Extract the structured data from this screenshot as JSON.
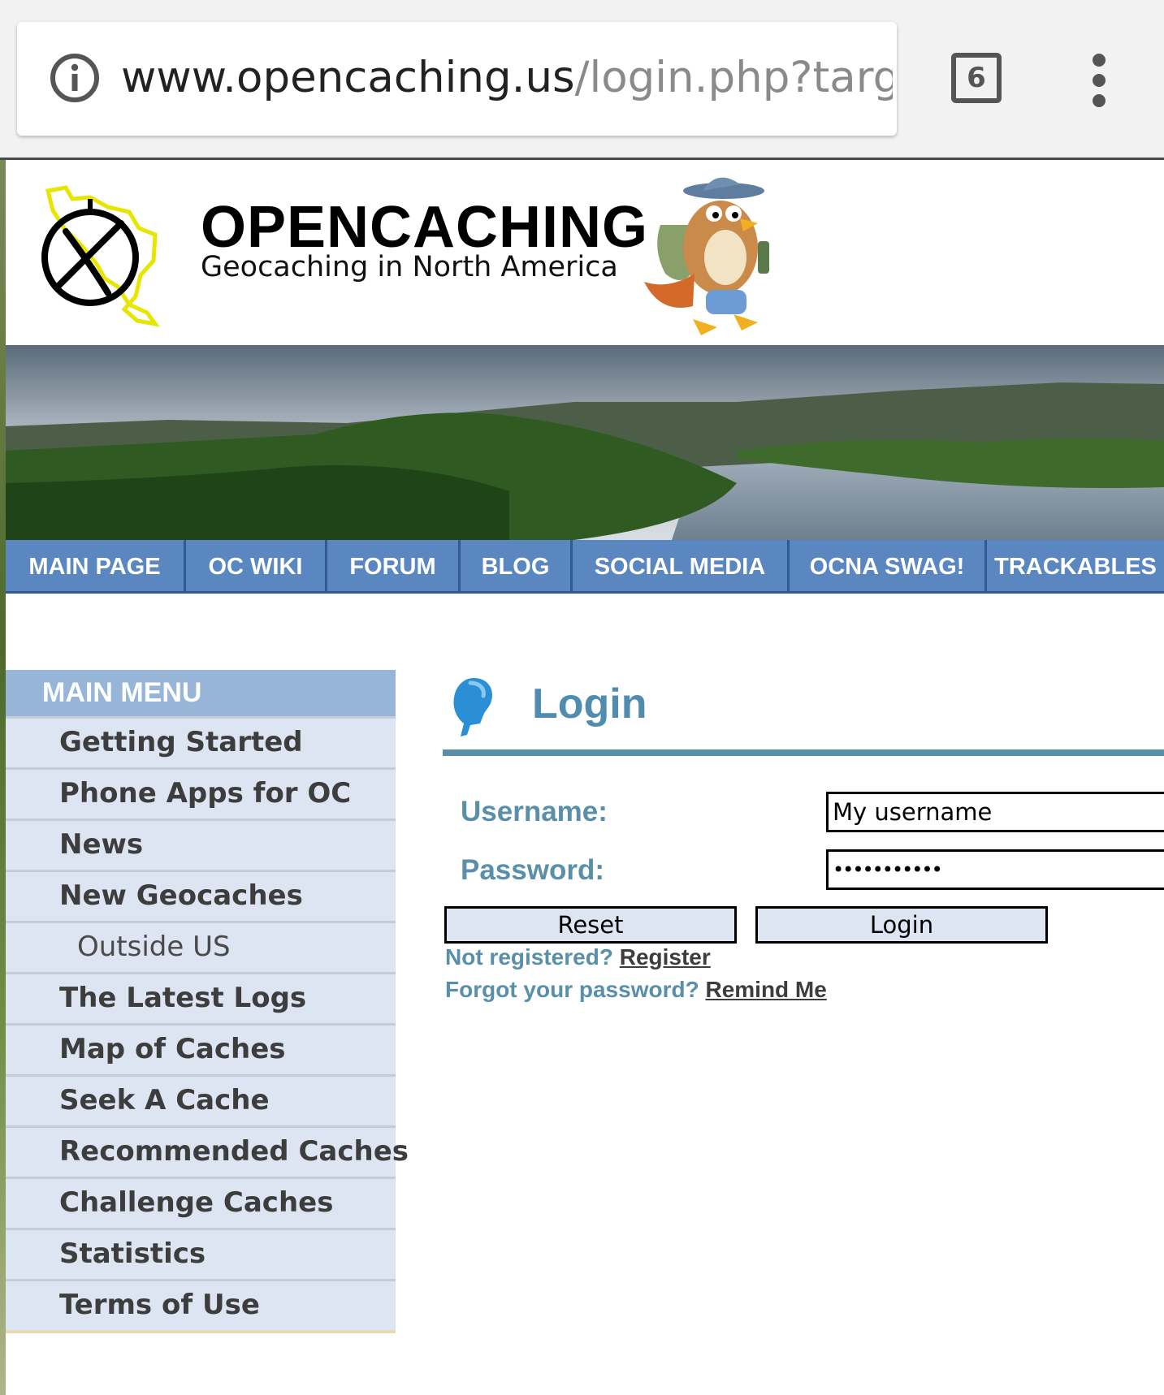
{
  "browser": {
    "url_host": "www.opencaching.us",
    "url_path": "/login.php?target=ol",
    "tab_count": "6",
    "icons": [
      "info-icon",
      "tab-counter-icon",
      "overflow-menu-icon"
    ]
  },
  "header": {
    "title": "OPENCACHING",
    "subtitle": "Geocaching in North America"
  },
  "topnav": {
    "items": [
      {
        "label": "MAIN PAGE"
      },
      {
        "label": "OC WIKI"
      },
      {
        "label": "FORUM"
      },
      {
        "label": "BLOG"
      },
      {
        "label": "SOCIAL MEDIA"
      },
      {
        "label": "OCNA SWAG!"
      },
      {
        "label": "TRACKABLES"
      }
    ]
  },
  "sidebar": {
    "header": "MAIN MENU",
    "items": [
      {
        "label": "Getting Started"
      },
      {
        "label": "Phone Apps for OC"
      },
      {
        "label": "News"
      },
      {
        "label": "New Geocaches"
      },
      {
        "label": "Outside US"
      },
      {
        "label": "The Latest Logs"
      },
      {
        "label": "Map of Caches"
      },
      {
        "label": "Seek A Cache"
      },
      {
        "label": "Recommended Caches"
      },
      {
        "label": "Challenge Caches"
      },
      {
        "label": "Statistics"
      },
      {
        "label": "Terms of Use"
      }
    ]
  },
  "login": {
    "title": "Login",
    "username_label": "Username:",
    "username_value": "My username",
    "password_label": "Password:",
    "password_value": "•••••••••••",
    "reset_label": "Reset",
    "login_label": "Login",
    "not_registered": "Not registered?",
    "register_link": "Register",
    "forgot": "Forgot your password?",
    "remind_link": "Remind Me"
  },
  "colors": {
    "nav_bg": "#5b87c0",
    "sidebar_header": "#97b5d6",
    "sidebar_item": "#dce5f1",
    "login_accent": "#5a8fa9"
  }
}
